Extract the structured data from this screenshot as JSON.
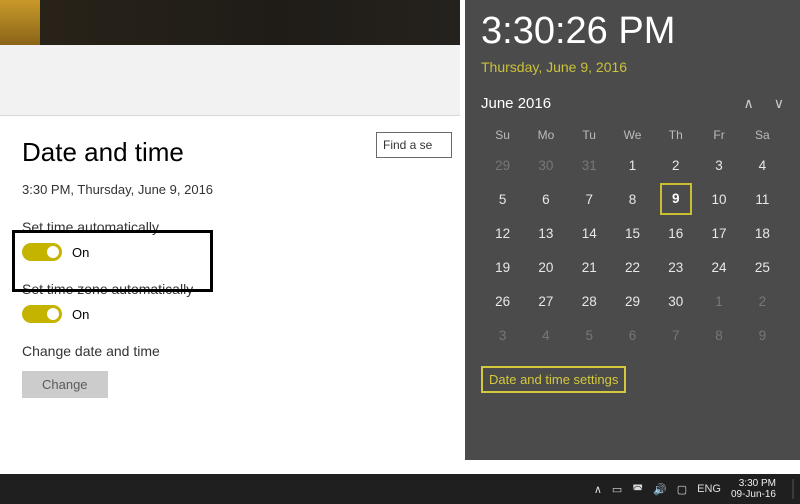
{
  "top": {
    "search_placeholder": "Find a se"
  },
  "settings": {
    "heading": "Date and time",
    "now": "3:30 PM, Thursday, June 9, 2016",
    "auto_time": {
      "label": "Set time automatically",
      "state": "On"
    },
    "auto_tz": {
      "label": "Set time zone automatically",
      "state": "On"
    },
    "change_label": "Change date and time",
    "change_btn": "Change"
  },
  "flyout": {
    "time": "3:30:26 PM",
    "date": "Thursday, June 9, 2016",
    "month": "June 2016",
    "dow": [
      "Su",
      "Mo",
      "Tu",
      "We",
      "Th",
      "Fr",
      "Sa"
    ],
    "weeks": [
      [
        {
          "n": 29,
          "dim": true
        },
        {
          "n": 30,
          "dim": true
        },
        {
          "n": 31,
          "dim": true
        },
        {
          "n": 1
        },
        {
          "n": 2
        },
        {
          "n": 3
        },
        {
          "n": 4
        }
      ],
      [
        {
          "n": 5
        },
        {
          "n": 6
        },
        {
          "n": 7
        },
        {
          "n": 8
        },
        {
          "n": 9,
          "today": true
        },
        {
          "n": 10
        },
        {
          "n": 11
        }
      ],
      [
        {
          "n": 12
        },
        {
          "n": 13
        },
        {
          "n": 14
        },
        {
          "n": 15
        },
        {
          "n": 16
        },
        {
          "n": 17
        },
        {
          "n": 18
        }
      ],
      [
        {
          "n": 19
        },
        {
          "n": 20
        },
        {
          "n": 21
        },
        {
          "n": 22
        },
        {
          "n": 23
        },
        {
          "n": 24
        },
        {
          "n": 25
        }
      ],
      [
        {
          "n": 26
        },
        {
          "n": 27
        },
        {
          "n": 28
        },
        {
          "n": 29
        },
        {
          "n": 30
        },
        {
          "n": 1,
          "dim": true
        },
        {
          "n": 2,
          "dim": true
        }
      ],
      [
        {
          "n": 3,
          "dim": true
        },
        {
          "n": 4,
          "dim": true
        },
        {
          "n": 5,
          "dim": true
        },
        {
          "n": 6,
          "dim": true
        },
        {
          "n": 7,
          "dim": true
        },
        {
          "n": 8,
          "dim": true
        },
        {
          "n": 9,
          "dim": true
        }
      ]
    ],
    "link": "Date and time settings"
  },
  "taskbar": {
    "lang": "ENG",
    "time": "3:30 PM",
    "date": "09-Jun-16"
  }
}
